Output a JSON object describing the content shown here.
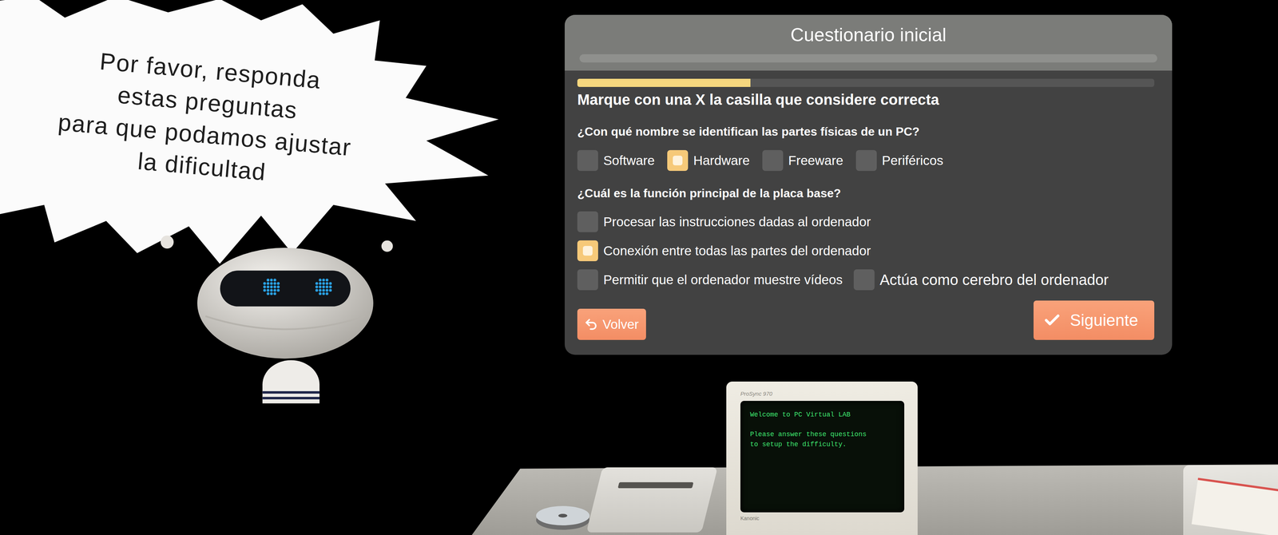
{
  "speech_bubble": {
    "lines": [
      "Por favor, responda",
      "estas preguntas",
      "para que podamos ajustar",
      "la dificultad"
    ]
  },
  "quiz": {
    "title": "Cuestionario inicial",
    "progress": {
      "level": 0.3
    },
    "instruction": "Marque con una X la casilla que considere correcta",
    "questions": [
      {
        "text": "¿Con qué nombre se identifican las partes físicas de un PC?",
        "kind": "inline",
        "options": [
          {
            "label": "Software",
            "selected": false
          },
          {
            "label": "Hardware",
            "selected": true
          },
          {
            "label": "Freeware",
            "selected": false
          },
          {
            "label": "Periféricos",
            "selected": false
          }
        ]
      },
      {
        "text": "¿Cuál es la función principal de la placa base?",
        "kind": "stacked",
        "options": [
          {
            "label": "Procesar las instrucciones dadas al ordenador",
            "selected": false
          },
          {
            "label": "Conexión entre todas las partes del ordenador",
            "selected": true
          },
          {
            "label": "Permitir que el ordenador muestre vídeos",
            "selected": false
          },
          {
            "label": "Actúa como cerebro del ordenador",
            "selected": false
          }
        ]
      }
    ],
    "buttons": [
      {
        "label": "Volver",
        "kind": "back"
      },
      {
        "label": "Siguiente",
        "kind": "next"
      }
    ]
  },
  "monitor": {
    "brand": "ProSync 970",
    "maker": "Kanonic",
    "screen_paragraphs": [
      [
        "Welcome to PC Virtual LAB"
      ],
      [
        "Please answer these questions",
        "to setup the difficulty."
      ]
    ]
  }
}
